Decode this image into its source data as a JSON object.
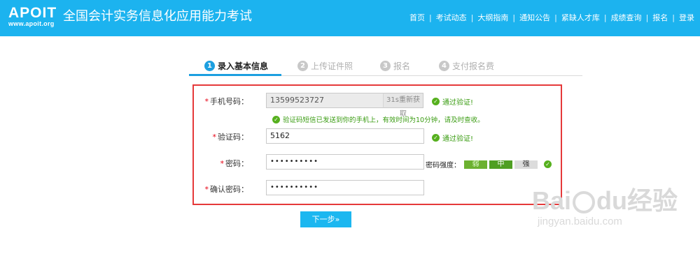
{
  "header": {
    "logo_text": "APOIT",
    "logo_url": "www.apoit.org",
    "site_title": "全国会计实务信息化应用能力考试",
    "nav": [
      "首页",
      "考试动态",
      "大纲指南",
      "通知公告",
      "紧缺人才库",
      "成绩查询",
      "报名",
      "登录"
    ]
  },
  "steps": [
    {
      "num": "1",
      "label": "录入基本信息"
    },
    {
      "num": "2",
      "label": "上传证件照"
    },
    {
      "num": "3",
      "label": "报名"
    },
    {
      "num": "4",
      "label": "支付报名费"
    }
  ],
  "form": {
    "required_mark": "*",
    "phone_label": "手机号码：",
    "phone_value": "13599523727",
    "resend_label": "31s重新获取",
    "verified_text": "通过验证!",
    "sms_notice": "验证码短信已发送到你的手机上，有效时间为10分钟，请及时查收。",
    "code_label": "验证码：",
    "code_value": "5162",
    "password_label": "密码：",
    "password_value": "••••••••••",
    "confirm_label": "确认密码：",
    "confirm_value": "••••••••••",
    "strength_label": "密码强度：",
    "strength_levels": [
      "弱",
      "中",
      "强"
    ]
  },
  "next_button": "下一步»",
  "watermark": {
    "main_left": "Bai",
    "main_right": "du",
    "main_cn": "经验",
    "sub": "jingyan.baidu.com"
  },
  "colors": {
    "header_bg": "#1cb3ef",
    "step_active": "#1c9fe0",
    "form_border": "#e5393a",
    "ok_green": "#3a9c12",
    "button_bg": "#1cb7f0"
  }
}
